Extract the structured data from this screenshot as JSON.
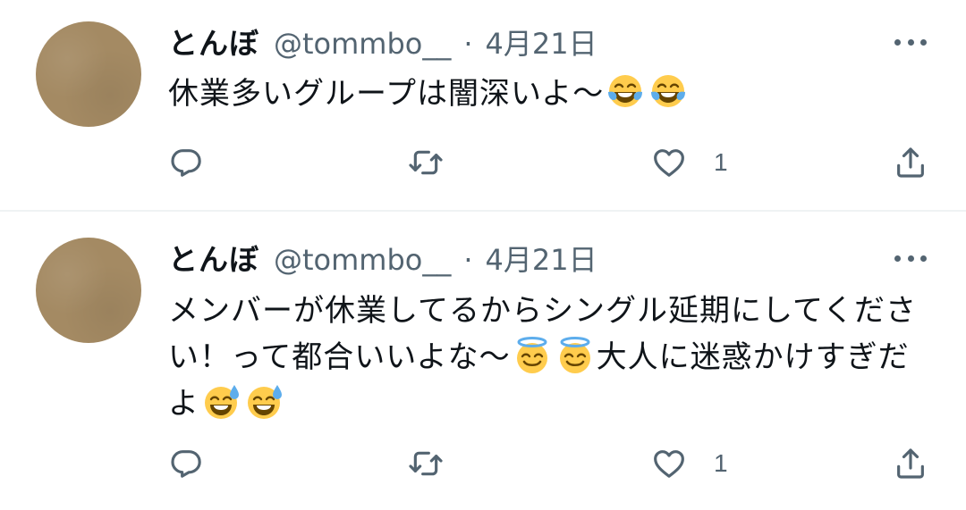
{
  "colors": {
    "text": "#0f1419",
    "secondary": "#536471",
    "divider": "#eff3f4",
    "avatar": "#a48a63"
  },
  "tweets": [
    {
      "display_name": "とんぼ",
      "handle": "@tommbo__",
      "separator": "·",
      "time": "4月21日",
      "text_before": "休業多いグループは闇深いよ〜",
      "emojis": [
        "face-with-tears-of-joy-icon",
        "face-with-tears-of-joy-icon"
      ],
      "like_count": "1",
      "icons": [
        "reply-icon",
        "retweet-icon",
        "like-icon",
        "share-icon",
        "more-icon"
      ]
    },
    {
      "display_name": "とんぼ",
      "handle": "@tommbo__",
      "separator": "·",
      "time": "4月21日",
      "text_part1": "メンバーが休業してるからシングル延期にしてください！って都合いいよな〜",
      "text_part2": "大人に迷惑かけすぎだよ",
      "emojis_a": [
        "smiling-face-with-halo-icon",
        "smiling-face-with-halo-icon"
      ],
      "emojis_b": [
        "grinning-face-with-sweat-icon",
        "grinning-face-with-sweat-icon"
      ],
      "like_count": "1",
      "icons": [
        "reply-icon",
        "retweet-icon",
        "like-icon",
        "share-icon",
        "more-icon"
      ]
    }
  ]
}
